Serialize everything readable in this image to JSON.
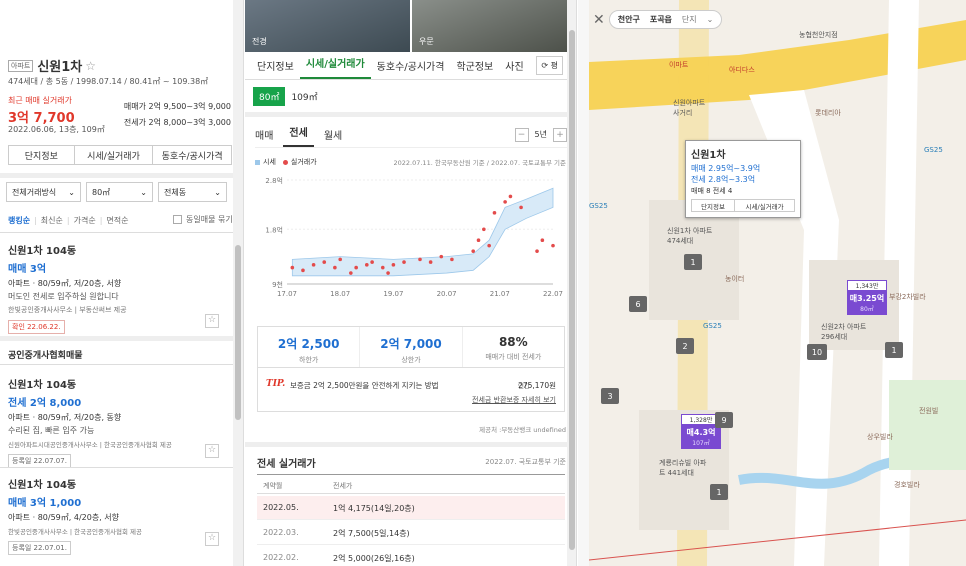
{
  "left": {
    "apt_badge": "아파트",
    "name": "신원1차",
    "star": "☆",
    "meta": "474세대 / 총 5동 / 1998.07.14 / 80.41㎡ ~ 109.38㎡",
    "recent_label": "최근 매매 실거래가",
    "recent_price": "3억 7,700",
    "recent_date": "2022.06.06, 13층, 109㎡",
    "sale_range": "매매가 2억 9,500~3억 9,000",
    "lease_range": "전세가 2억 8,000~3억 3,000",
    "buttons": [
      "단지정보",
      "시세/실거래가",
      "동호수/공시가격"
    ],
    "filters": [
      "전체거래방식",
      "80㎡",
      "전체동"
    ],
    "sort": [
      "랭킹순",
      "최신순",
      "가격순",
      "면적순"
    ],
    "same_check": "동일매물 묶기",
    "listings1": [
      {
        "title": "신원1차 104동",
        "price": "매매 3억",
        "price_class": "deal",
        "detail": "아파트 · 80/59㎡, 저/20층, 서향",
        "desc": "머도인 전세로 입주하실 원합니다",
        "agent": "한빛공인중개사사무소 | 부동산써브 제공",
        "date": "확인 22.06.22."
      }
    ],
    "section_title": "공인중개사협회매물",
    "listings2": [
      {
        "title": "신원1차 104동",
        "price": "전세 2억 8,000",
        "detail": "아파트 · 80/59㎡, 저/20층, 동향",
        "desc": "수리된 집, 빠른 입주 가능",
        "agent": "신원아파트시대공인중개사사무소 | 한국공인중개사협회 제공",
        "date": "등록일 22.07.07."
      },
      {
        "title": "신원1차 104동",
        "price": "매매 3억 1,000",
        "detail": "아파트 · 80/59㎡, 4/20층, 서향",
        "desc": "",
        "agent": "한빛공인중개사사무소 | 한국공인중개사협회 제공",
        "date": "등록일 22.07.01."
      }
    ]
  },
  "mid": {
    "photo_labels": [
      "전경",
      "우문"
    ],
    "tabs": [
      "단지정보",
      "시세/실거래가",
      "동호수/공시가격",
      "학군정보",
      "사진"
    ],
    "refresh": "⟳ 평",
    "areas": [
      "80㎡",
      "109㎡"
    ],
    "subtabs": [
      "매매",
      "전세",
      "월세"
    ],
    "period": "5년",
    "legend_market": "시세",
    "legend_real": "실거래가",
    "source": "2022.07.11. 한국부동산원 기준 / 2022.07. 국토교통부 기준",
    "stats": [
      {
        "value": "2억 2,500",
        "label": "하한가"
      },
      {
        "value": "2억 7,000",
        "label": "상한가"
      },
      {
        "value": "88%",
        "label": "매매가 대비 전세가"
      }
    ],
    "tip_label": "TIP.",
    "tip_text": "보증금 2억 2,500만원을 안전하게 지키는 방법",
    "tip_cost_label": "연간",
    "tip_cost": "275,170원",
    "tip_link": "전세금 반환보증 자세히 보기",
    "provider": "제공처 :부동산뱅크 undefined",
    "real_title": "전세 실거래가",
    "real_source": "2022.07. 국토교통부 기준",
    "table_headers": [
      "계약월",
      "전세가"
    ],
    "table_rows": [
      {
        "month": "2022.05.",
        "price": "1억 4,175(14일,20층)"
      },
      {
        "month": "2022.03.",
        "price": "2억 7,500(5일,14층)"
      },
      {
        "month": "2022.02.",
        "price": "2억 5,000(26일,16층)"
      }
    ]
  },
  "chart_data": {
    "type": "scatter",
    "x_ticks": [
      "17.07",
      "18.07",
      "19.07",
      "20.07",
      "21.07",
      "22.07"
    ],
    "y_ticks": [
      "2.8억",
      "1.8억",
      "9천"
    ],
    "ylim": [
      0.9,
      2.8
    ],
    "series": [
      {
        "name": "시세",
        "kind": "band",
        "x": [
          2017.6,
          2018.5,
          2019.5,
          2020.5,
          2021.0,
          2021.3,
          2021.6,
          2022.0,
          2022.5
        ],
        "low": [
          1.05,
          1.05,
          1.05,
          1.1,
          1.15,
          1.4,
          1.9,
          2.1,
          2.3
        ],
        "high": [
          1.35,
          1.4,
          1.35,
          1.4,
          1.45,
          1.7,
          2.3,
          2.45,
          2.65
        ]
      },
      {
        "name": "실거래가",
        "kind": "points",
        "x": [
          2017.6,
          2017.8,
          2018.0,
          2018.2,
          2018.4,
          2018.5,
          2018.7,
          2018.8,
          2019.0,
          2019.1,
          2019.3,
          2019.4,
          2019.5,
          2019.7,
          2020.0,
          2020.2,
          2020.4,
          2020.6,
          2021.0,
          2021.1,
          2021.2,
          2021.3,
          2021.4,
          2021.6,
          2021.7,
          2021.9,
          2022.2,
          2022.3,
          2022.5
        ],
        "y": [
          1.2,
          1.15,
          1.25,
          1.3,
          1.2,
          1.35,
          1.1,
          1.2,
          1.25,
          1.3,
          1.2,
          1.1,
          1.25,
          1.3,
          1.35,
          1.3,
          1.4,
          1.35,
          1.5,
          1.7,
          1.9,
          1.6,
          2.2,
          2.4,
          2.5,
          2.3,
          1.5,
          1.7,
          1.6
        ]
      }
    ]
  },
  "map": {
    "filters": [
      "천안구",
      "포곡읍",
      "단지"
    ],
    "popup_name": "신원1차",
    "popup_sale": "매매 2.95억~3.9억",
    "popup_lease": "전세 2.8억~3.3억",
    "popup_counts": "매매 8  전세 4",
    "popup_btns": [
      "단지정보",
      "시세/실거래가"
    ],
    "markers": [
      {
        "top": "1,343만",
        "label": "매3.25억",
        "sub": "80㎡"
      },
      {
        "top": "1,328만",
        "label": "매4.3억",
        "sub": "107㎡"
      }
    ],
    "counts": [
      "1",
      "6",
      "2",
      "10",
      "1",
      "3",
      "9",
      "1"
    ],
    "places": [
      "신원1차 아파트 474세대",
      "신원2차 아파트 296세대",
      "계룡리슈빌 아파트 441세대",
      "부강2차빌라",
      "농협천안지점",
      "아디다스",
      "이마트",
      "GS25",
      "GS25",
      "GS25",
      "농이터",
      "신원아파트 사거리",
      "롯데리아",
      "경호빌라",
      "전원빌",
      "상우빌라"
    ]
  }
}
